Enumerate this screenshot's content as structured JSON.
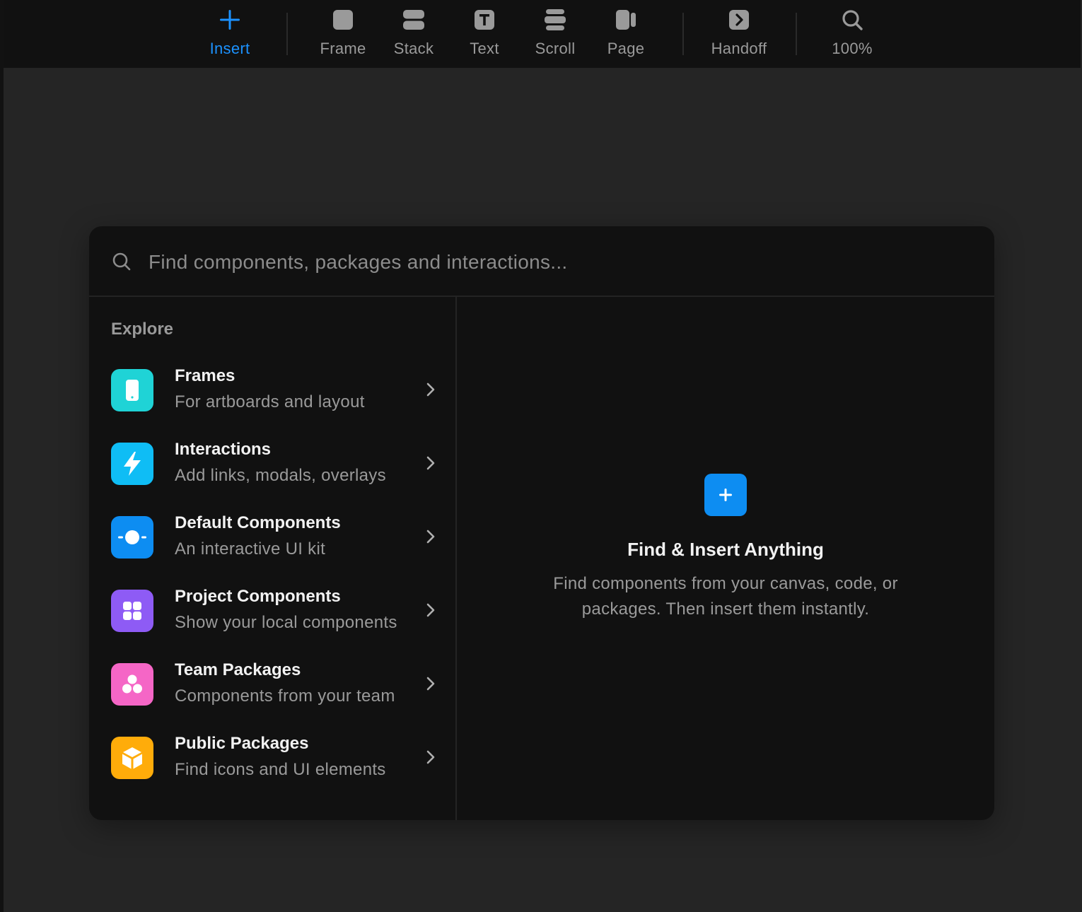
{
  "toolbar": {
    "items": [
      {
        "label": "Insert",
        "icon": "plus-icon",
        "active": true
      },
      {
        "label": "Frame",
        "icon": "frame-icon"
      },
      {
        "label": "Stack",
        "icon": "stack-icon"
      },
      {
        "label": "Text",
        "icon": "text-icon"
      },
      {
        "label": "Scroll",
        "icon": "scroll-icon"
      },
      {
        "label": "Page",
        "icon": "page-icon"
      },
      {
        "label": "Handoff",
        "icon": "handoff-icon"
      },
      {
        "label": "100%",
        "icon": "zoom-icon"
      }
    ]
  },
  "insert_panel": {
    "search": {
      "placeholder": "Find components, packages and interactions...",
      "value": ""
    },
    "explore": {
      "title": "Explore",
      "items": [
        {
          "title": "Frames",
          "subtitle": "For artboards and layout",
          "icon": "phone-icon",
          "color": "#1fd3d6"
        },
        {
          "title": "Interactions",
          "subtitle": "Add links, modals, overlays",
          "icon": "lightning-icon",
          "color": "#0fbdf5"
        },
        {
          "title": "Default Components",
          "subtitle": "An interactive UI kit",
          "icon": "slider-toggle-icon",
          "color": "#0d8df2"
        },
        {
          "title": "Project Components",
          "subtitle": "Show your local components",
          "icon": "grid-icon",
          "color": "#8e5bf5"
        },
        {
          "title": "Team Packages",
          "subtitle": "Components from your team",
          "icon": "team-circles-icon",
          "color": "#f566c6"
        },
        {
          "title": "Public Packages",
          "subtitle": "Find icons and UI elements",
          "icon": "cube-icon",
          "color": "#ffac0a"
        }
      ]
    },
    "empty_state": {
      "icon": "plus-icon",
      "title": "Find & Insert Anything",
      "description": "Find components from your canvas, code, or packages. Then insert them instantly."
    }
  },
  "colors": {
    "accent": "#1c92ff",
    "toolbar_bg": "#111111",
    "canvas_bg": "#252525",
    "panel_bg": "#111111"
  }
}
